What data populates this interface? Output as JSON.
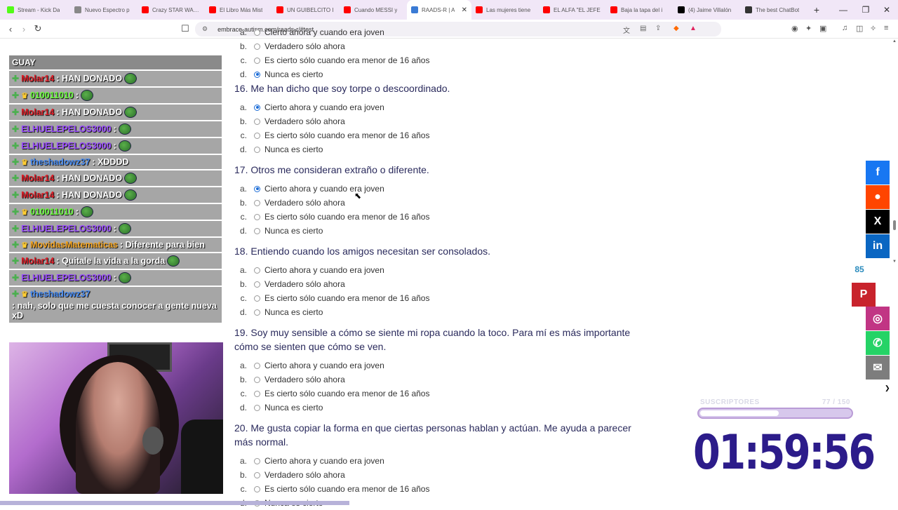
{
  "tabs": [
    {
      "title": "Stream - Kick Da",
      "color": "#53fc18"
    },
    {
      "title": "Nuevo Espectro p",
      "color": "#888888"
    },
    {
      "title": "Crazy STAR WARS",
      "color": "#ff0000"
    },
    {
      "title": "El Libro Más Mist",
      "color": "#ff0000"
    },
    {
      "title": "UN GUIBELCITO I",
      "color": "#ff0000"
    },
    {
      "title": "Cuando MESSI y",
      "color": "#ff0000"
    },
    {
      "title": "RAADS-R | A",
      "color": "#3a7bd5",
      "active": true
    },
    {
      "title": "Las mujeres tiene",
      "color": "#ff0000"
    },
    {
      "title": "EL ALFA \"EL JEFE",
      "color": "#ff0000"
    },
    {
      "title": "Baja la tapa del i",
      "color": "#ff0000"
    },
    {
      "title": "(4) Jaime Villalón",
      "color": "#000000"
    },
    {
      "title": "The best ChatBot",
      "color": "#333333"
    }
  ],
  "url": "embrace-autism.com/raads-r/#test",
  "chat": {
    "title": "GUAY",
    "messages": [
      {
        "user": "Molar14",
        "color": "#e0202a",
        "text": ": HAN DONADO",
        "crown": false,
        "emote": true
      },
      {
        "user": "010011010",
        "color": "#69ff3a",
        "text": ":",
        "crown": true,
        "emote": true
      },
      {
        "user": "Molar14",
        "color": "#e0202a",
        "text": ": HAN DONADO",
        "crown": false,
        "emote": true
      },
      {
        "user": "ELHUELEPELOS3000",
        "color": "#9b4dff",
        "text": ":",
        "crown": false,
        "emote": true
      },
      {
        "user": "ELHUELEPELOS3000",
        "color": "#9b4dff",
        "text": ":",
        "crown": false,
        "emote": true
      },
      {
        "user": "theshadowz37",
        "color": "#4a8df2",
        "text": ": XDDDD",
        "crown": true,
        "emote": false
      },
      {
        "user": "Molar14",
        "color": "#e0202a",
        "text": ": HAN DONADO",
        "crown": false,
        "emote": true
      },
      {
        "user": "Molar14",
        "color": "#e0202a",
        "text": ": HAN DONADO",
        "crown": false,
        "emote": true
      },
      {
        "user": "010011010",
        "color": "#69ff3a",
        "text": ":",
        "crown": true,
        "emote": true
      },
      {
        "user": "ELHUELEPELOS3000",
        "color": "#9b4dff",
        "text": ":",
        "crown": false,
        "emote": true
      },
      {
        "user": "MovidasMatematicas",
        "color": "#f5a623",
        "text": ": Diferente para bien",
        "crown": true,
        "emote": false
      },
      {
        "user": "Molar14",
        "color": "#e0202a",
        "text": ": Quitale la vida a la gorda",
        "crown": false,
        "emote": true
      },
      {
        "user": "ELHUELEPELOS3000",
        "color": "#9b4dff",
        "text": ":",
        "crown": false,
        "emote": true
      },
      {
        "user": "theshadowz37",
        "color": "#4a8df2",
        "text": ": nah, solo que me cuesta conocer a gente nueva xD",
        "crown": true,
        "emote": false
      }
    ]
  },
  "quiz": {
    "options": [
      "Cierto ahora y cuando era joven",
      "Verdadero sólo ahora",
      "Es cierto sólo cuando era menor de 16 años",
      "Nunca es cierto"
    ],
    "letters": [
      "a.",
      "b.",
      "c.",
      "d."
    ],
    "questions": [
      {
        "title": "",
        "selected": 3,
        "partial": true
      },
      {
        "title": "16. Me han dicho que soy torpe o descoordinado.",
        "selected": 0
      },
      {
        "title": "17. Otros me consideran extraño o diferente.",
        "selected": 0
      },
      {
        "title": "18. Entiendo cuando los amigos necesitan ser consolados.",
        "selected": -1
      },
      {
        "title": "19. Soy muy sensible a cómo se siente mi ropa cuando la toco. Para mí es más importante cómo se sienten que cómo se ven.",
        "selected": -1
      },
      {
        "title": "20. Me gusta copiar la forma en que ciertas personas hablan y actúan. Me ayuda a parecer más normal.",
        "selected": -1
      }
    ]
  },
  "social": {
    "share_count": "85",
    "buttons": [
      {
        "name": "facebook",
        "glyph": "f",
        "color": "#1877f2"
      },
      {
        "name": "reddit",
        "glyph": "●",
        "color": "#ff4500"
      },
      {
        "name": "x",
        "glyph": "X",
        "color": "#000000"
      },
      {
        "name": "linkedin",
        "glyph": "in",
        "color": "#0a66c2"
      }
    ],
    "pinterest": {
      "glyph": "P",
      "color": "#c8232c"
    },
    "buttons2": [
      {
        "name": "instagram",
        "glyph": "◎",
        "color": "#c13584"
      },
      {
        "name": "whatsapp",
        "glyph": "✆",
        "color": "#25d366"
      },
      {
        "name": "email",
        "glyph": "✉",
        "color": "#7d7d7d"
      }
    ]
  },
  "subs": {
    "label": "SUSCRIPTORES",
    "count": "77",
    "goal": "/ 150",
    "fraction": 0.513
  },
  "timer": "01:59:56"
}
